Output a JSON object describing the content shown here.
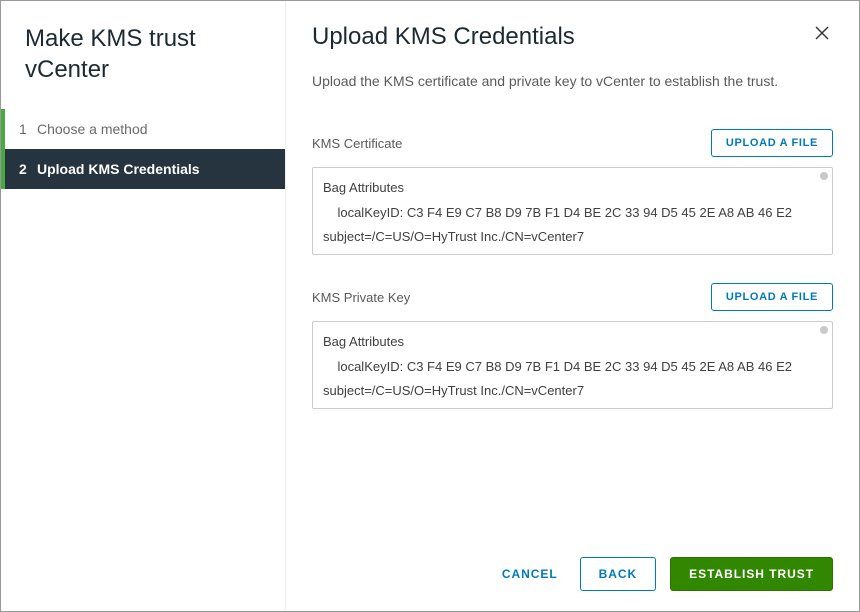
{
  "sidebar": {
    "title": "Make KMS trust vCenter",
    "steps": [
      {
        "num": "1",
        "label": "Choose a method"
      },
      {
        "num": "2",
        "label": "Upload KMS Credentials"
      }
    ]
  },
  "main": {
    "title": "Upload KMS Credentials",
    "description": "Upload the KMS certificate and private key to vCenter to establish the trust."
  },
  "cert": {
    "label": "KMS Certificate",
    "upload_label": "UPLOAD A FILE",
    "content": "Bag Attributes\n    localKeyID: C3 F4 E9 C7 B8 D9 7B F1 D4 BE 2C 33 94 D5 45 2E A8 AB 46 E2\nsubject=/C=US/O=HyTrust Inc./CN=vCenter7"
  },
  "key": {
    "label": "KMS Private Key",
    "upload_label": "UPLOAD A FILE",
    "content": "Bag Attributes\n    localKeyID: C3 F4 E9 C7 B8 D9 7B F1 D4 BE 2C 33 94 D5 45 2E A8 AB 46 E2\nsubject=/C=US/O=HyTrust Inc./CN=vCenter7"
  },
  "footer": {
    "cancel": "CANCEL",
    "back": "BACK",
    "establish": "ESTABLISH TRUST"
  }
}
